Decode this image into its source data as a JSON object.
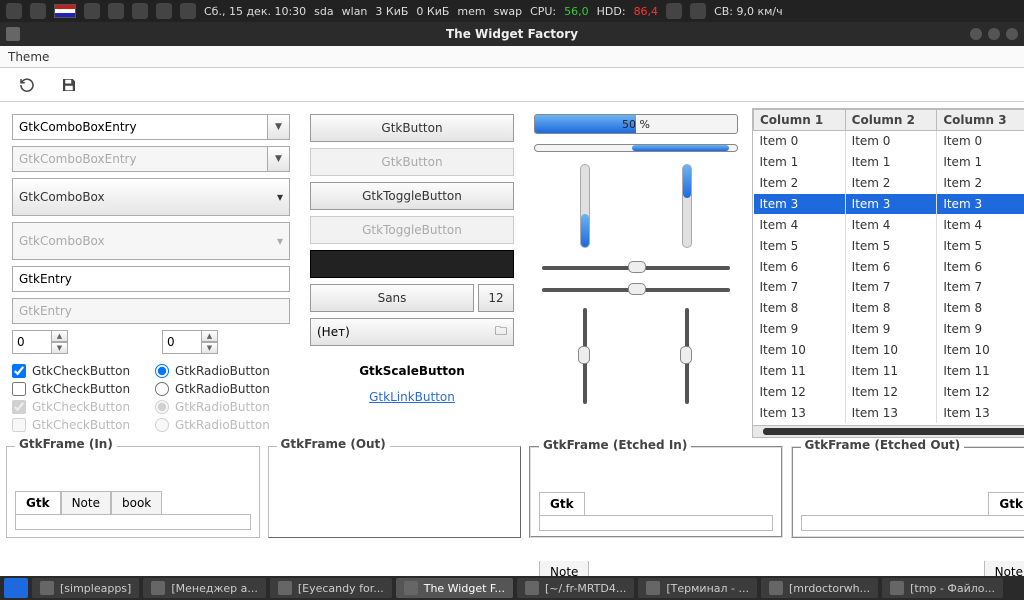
{
  "syspanel": {
    "date": "Сб., 15 дек. 10:30",
    "sda": "sda",
    "wlan": "wlan",
    "net_in": "3 КиБ",
    "net_out": "0 КиБ",
    "mem": "mem",
    "swap": "swap",
    "cpu_lbl": "CPU:",
    "cpu_val": "56,0",
    "hdd_lbl": "HDD:",
    "hdd_val": "86,4",
    "weather": "СВ: 9,0 км/ч"
  },
  "window": {
    "title": "The Widget Factory"
  },
  "menubar": {
    "items": [
      "Theme"
    ]
  },
  "col1": {
    "combo_entry": "GtkComboBoxEntry",
    "combo_entry_disabled": "GtkComboBoxEntry",
    "combo_box": "GtkComboBox",
    "combo_box_disabled": "GtkComboBox",
    "entry": "GtkEntry",
    "entry_disabled": "GtkEntry",
    "spin1": "0",
    "spin2": "0",
    "check_on": "GtkCheckButton",
    "radio_on": "GtkRadioButton",
    "check_off": "GtkCheckButton",
    "radio_off": "GtkRadioButton",
    "check_dis1": "GtkCheckButton",
    "radio_dis1": "GtkRadioButton",
    "check_dis2": "GtkCheckButton",
    "radio_dis2": "GtkRadioButton"
  },
  "col2": {
    "btn": "GtkButton",
    "btn_disabled": "GtkButton",
    "toggle": "GtkToggleButton",
    "toggle_disabled": "GtkToggleButton",
    "font_name": "Sans",
    "font_size": "12",
    "file_label": "(Нет)",
    "scale_label": "GtkScaleButton",
    "link": "GtkLinkButton"
  },
  "col3": {
    "progress_pct": 50,
    "progress_text": "50 %"
  },
  "table": {
    "headers": [
      "Column 1",
      "Column 2",
      "Column 3"
    ],
    "rows": [
      [
        "Item 0",
        "Item 0",
        "Item 0"
      ],
      [
        "Item 1",
        "Item 1",
        "Item 1"
      ],
      [
        "Item 2",
        "Item 2",
        "Item 2"
      ],
      [
        "Item 3",
        "Item 3",
        "Item 3"
      ],
      [
        "Item 4",
        "Item 4",
        "Item 4"
      ],
      [
        "Item 5",
        "Item 5",
        "Item 5"
      ],
      [
        "Item 6",
        "Item 6",
        "Item 6"
      ],
      [
        "Item 7",
        "Item 7",
        "Item 7"
      ],
      [
        "Item 8",
        "Item 8",
        "Item 8"
      ],
      [
        "Item 9",
        "Item 9",
        "Item 9"
      ],
      [
        "Item 10",
        "Item 10",
        "Item 10"
      ],
      [
        "Item 11",
        "Item 11",
        "Item 11"
      ],
      [
        "Item 12",
        "Item 12",
        "Item 12"
      ],
      [
        "Item 13",
        "Item 13",
        "Item 13"
      ]
    ],
    "selected_index": 3
  },
  "frames": {
    "in": "GtkFrame (In)",
    "out": "GtkFrame (Out)",
    "etched_in": "GtkFrame (Etched In)",
    "etched_out": "GtkFrame (Etched Out)",
    "tab_gtk": "Gtk",
    "tab_note": "Note",
    "tab_book": "book"
  },
  "taskbar": {
    "items": [
      "[simpleapps]",
      "[Менеджер а...",
      "[Eyecandy for...",
      "The Widget F...",
      "[~/.fr-MRTD4...",
      "[Терминал - ...",
      "[mrdoctorwh...",
      "[tmp - Файло..."
    ],
    "active_index": 3
  }
}
